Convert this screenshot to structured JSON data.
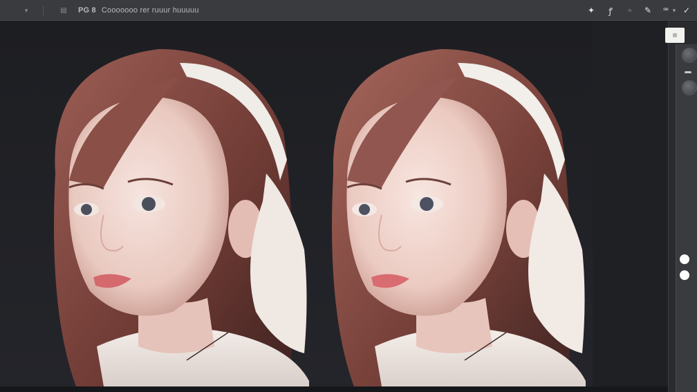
{
  "topbar": {
    "chevron_icon": "chevron-down-icon",
    "file_icon": "document-icon",
    "title_code": "PG 8",
    "title_name": "Cooooooo rer ruuur huuuuu",
    "tools": [
      "move-icon",
      "lasso-icon",
      "brush-icon",
      "pen-icon",
      "eyedropper-icon",
      "dropdown-icon",
      "swap-icon"
    ]
  },
  "canvas": {
    "documents": [
      "before",
      "after"
    ]
  },
  "panel": {
    "top_button_icon": "square-icon",
    "knobs": [
      "dial-icon",
      "dial-icon"
    ],
    "indicators": [
      "dot-indicator",
      "dot-indicator"
    ]
  },
  "colors": {
    "topbar": "#3a3b3f",
    "canvas": "#1f2024",
    "panel": "#2a2b2f",
    "accent_white": "#ffffff"
  }
}
